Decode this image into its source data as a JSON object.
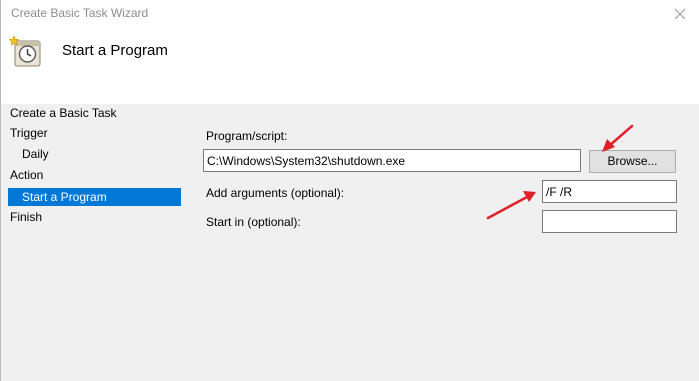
{
  "window": {
    "title": "Create Basic Task Wizard",
    "close_glyph": "✕",
    "icon": "close-icon"
  },
  "header": {
    "title": "Start a Program",
    "icon": "task-scheduler-clock-icon"
  },
  "nav": {
    "items": [
      {
        "label": "Create a Basic Task",
        "indent": false,
        "selected": false
      },
      {
        "label": "Trigger",
        "indent": false,
        "selected": false
      },
      {
        "label": "Daily",
        "indent": true,
        "selected": false
      },
      {
        "label": "Action",
        "indent": false,
        "selected": false
      },
      {
        "label": "Start a Program",
        "indent": true,
        "selected": true
      },
      {
        "label": "Finish",
        "indent": false,
        "selected": false
      }
    ]
  },
  "form": {
    "program_label": "Program/script:",
    "program_value": "C:\\Windows\\System32\\shutdown.exe",
    "browse_label": "Browse...",
    "args_label": "Add arguments (optional):",
    "args_value": "/F /R",
    "start_in_label": "Start in (optional):",
    "start_in_value": ""
  },
  "colors": {
    "selection": "#0078d7",
    "annotation_arrow": "#e0202a",
    "panel_background": "#f0f0f0"
  }
}
